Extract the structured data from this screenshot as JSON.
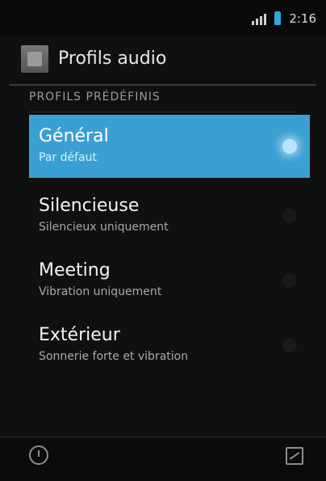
{
  "status_bar": {
    "time": "2:16"
  },
  "action_bar": {
    "title": "Profils audio"
  },
  "section": {
    "header": "PROFILS PRÉDÉFINIS"
  },
  "profiles": [
    {
      "title": "Général",
      "subtitle": "Par défaut",
      "selected": true
    },
    {
      "title": "Silencieuse",
      "subtitle": "Silencieux uniquement",
      "selected": false
    },
    {
      "title": "Meeting",
      "subtitle": "Vibration uniquement",
      "selected": false
    },
    {
      "title": "Extérieur",
      "subtitle": "Sonnerie forte et vibration",
      "selected": false
    }
  ],
  "colors": {
    "accent": "#3aa0d3"
  },
  "icons": {
    "status_signal": "signal-icon",
    "status_battery": "battery-icon",
    "app": "audio-profiles-app-icon",
    "bottom_left": "power-icon",
    "bottom_right": "edit-icon"
  }
}
